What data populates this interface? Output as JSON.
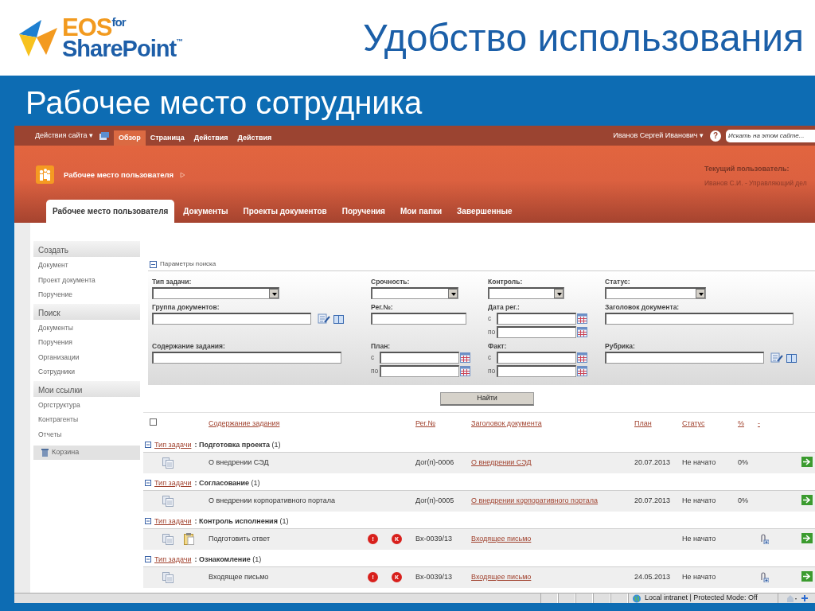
{
  "slide": {
    "logo": {
      "brand": "EOS",
      "joiner": "for",
      "product": "SharePoint",
      "trademark": "™"
    },
    "title": "Удобство использования",
    "subtitle": "Рабочее место сотрудника"
  },
  "ribbon": {
    "site_actions": "Действия сайта ▾",
    "tabs": [
      {
        "label": "Обзор",
        "selected": true
      },
      {
        "label": "Страница",
        "selected": false
      },
      {
        "label": "Действия",
        "selected": false
      },
      {
        "label": "Действия",
        "selected": false
      }
    ],
    "user": "Иванов Сергей Иванович ▾",
    "help": "?",
    "search": {
      "placeholder": "Искать на этом сайте..."
    }
  },
  "site_header": {
    "title": "Рабочее место пользователя",
    "current_user_label": "Текущий пользователь:",
    "current_user": "Иванов С.И. - Управляющий дел"
  },
  "nav_tabs": [
    {
      "label": "Рабочее место пользователя",
      "selected": true
    },
    {
      "label": "Документы",
      "selected": false
    },
    {
      "label": "Проекты документов",
      "selected": false
    },
    {
      "label": "Поручения",
      "selected": false
    },
    {
      "label": "Мои папки",
      "selected": false
    },
    {
      "label": "Завершенные",
      "selected": false
    }
  ],
  "sidebar": {
    "sections": [
      {
        "heading": "Создать",
        "items": [
          "Документ",
          "Проект документа",
          "Поручение"
        ]
      },
      {
        "heading": "Поиск",
        "items": [
          "Документы",
          "Поручения",
          "Организации",
          "Сотрудники"
        ]
      },
      {
        "heading": "Мои ссылки",
        "items": [
          "Оргструктура",
          "Контрагенты",
          "Отчеты"
        ]
      }
    ],
    "recycle_bin": "Корзина"
  },
  "search_panel": {
    "title": "Параметры поиска",
    "expanded": true,
    "rows": [
      [
        {
          "kind": "select",
          "label": "Тип задачи:"
        },
        {
          "kind": "select",
          "label": "Срочность:"
        },
        {
          "kind": "select",
          "label": "Контроль:"
        },
        {
          "kind": "select",
          "label": "Статус:"
        }
      ],
      [
        {
          "kind": "lookup",
          "label": "Группа документов:"
        },
        {
          "kind": "text",
          "label": "Рег.№:"
        },
        {
          "kind": "daterange",
          "label": "Дата рег.:",
          "from": "с",
          "to": "по"
        },
        {
          "kind": "text",
          "label": "Заголовок документа:"
        }
      ],
      [
        {
          "kind": "text",
          "label": "Содержание задания:"
        },
        {
          "kind": "daterange",
          "label": "План:",
          "from": "с",
          "to": "по"
        },
        {
          "kind": "daterange",
          "label": "Факт:",
          "from": "с",
          "to": "по"
        },
        {
          "kind": "lookup",
          "label": "Рубрика:"
        }
      ]
    ],
    "find_button": "Найти"
  },
  "tasks": {
    "select_all": false,
    "columns": [
      "Содержание задания",
      "Рег.№",
      "Заголовок документа",
      "План",
      "Статус",
      "%",
      "-"
    ],
    "groups": [
      {
        "field": "Тип задачи",
        "separator": ":",
        "value": "Подготовка проекта",
        "count": "(1)",
        "expanded": true,
        "rows": [
          {
            "task": "О внедрении СЭД",
            "reg_no": "Дог(п)-0006",
            "document": "О внедрении СЭД",
            "plan": "20.07.2013",
            "status": "Не начато",
            "percent": "0%",
            "resolution": false,
            "attachment": false
          }
        ]
      },
      {
        "field": "Тип задачи",
        "separator": ":",
        "value": "Согласование",
        "count": "(1)",
        "expanded": true,
        "rows": [
          {
            "task": "О внедрении корпоративного портала",
            "reg_no": "Дог(п)-0005",
            "document": "О внедрении корпоративного портала",
            "plan": "20.07.2013",
            "status": "Не начато",
            "percent": "0%",
            "resolution": false,
            "attachment": false
          }
        ]
      },
      {
        "field": "Тип задачи",
        "separator": ":",
        "value": "Контроль исполнения",
        "count": "(1)",
        "expanded": true,
        "rows": [
          {
            "task": "Подготовить ответ",
            "urgent": "!",
            "control": "К",
            "reg_no": "Вх-0039/13",
            "document": "Входящее письмо",
            "status": "Не начато",
            "resolution": true,
            "attachment": true
          }
        ]
      },
      {
        "field": "Тип задачи",
        "separator": ":",
        "value": "Ознакомление",
        "count": "(1)",
        "expanded": true,
        "rows": [
          {
            "task": "Входящее письмо",
            "urgent": "!",
            "control": "К",
            "reg_no": "Вх-0039/13",
            "document": "Входящее письмо",
            "plan": "24.05.2013",
            "status": "Не начато",
            "resolution": false,
            "attachment": true
          }
        ]
      }
    ]
  },
  "status_bar": {
    "zone": "Local intranet | Protected Mode: Off"
  }
}
